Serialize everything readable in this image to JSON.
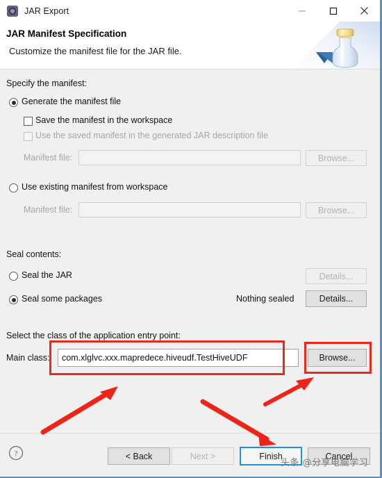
{
  "window": {
    "title": "JAR Export",
    "icon": "jar-export-gear-icon",
    "controls": {
      "minimize": "minimize-icon",
      "maximize": "maximize-icon",
      "close": "close-icon"
    },
    "accent_border_color": "#5d91c6"
  },
  "header": {
    "title": "JAR Manifest Specification",
    "subtitle": "Customize the manifest file for the JAR file.",
    "artwork": "jar-bottle-icon"
  },
  "manifest_section": {
    "group_label": "Specify the manifest:",
    "generate_radio": {
      "label": "Generate the manifest file",
      "checked": true
    },
    "save_checkbox": {
      "label": "Save the manifest in the workspace",
      "checked": false,
      "enabled": true
    },
    "use_saved_checkbox": {
      "label": "Use the saved manifest in the generated JAR description file",
      "checked": false,
      "enabled": false
    },
    "manifest_file_label": "Manifest file:",
    "manifest_file_value": "",
    "manifest_file_browse": "Browse...",
    "existing_radio": {
      "label": "Use existing manifest from workspace",
      "checked": false
    },
    "existing_file_label": "Manifest file:",
    "existing_file_value": "",
    "existing_file_browse": "Browse..."
  },
  "seal_section": {
    "group_label": "Seal contents:",
    "seal_jar_radio": {
      "label": "Seal the JAR",
      "checked": false
    },
    "seal_jar_details": "Details...",
    "seal_packages_radio": {
      "label": "Seal some packages",
      "checked": true
    },
    "seal_status": "Nothing sealed",
    "seal_packages_details": "Details..."
  },
  "entry_point_section": {
    "group_label": "Select the class of the application entry point:",
    "main_class_label": "Main class:",
    "main_class_value": "com.xlglvc.xxx.mapredece.hiveudf.TestHiveUDF",
    "browse_label": "Browse..."
  },
  "footer": {
    "help_icon": "help-question-icon",
    "back_label": "< Back",
    "back_enabled": true,
    "next_label": "Next >",
    "next_enabled": false,
    "finish_label": "Finish",
    "finish_is_default": true,
    "cancel_label": "Cancel"
  },
  "annotations": {
    "highlight_color": "#e8291c",
    "boxes": [
      "main-class-input-highlight",
      "browse-button-highlight"
    ],
    "arrows": [
      "arrow-to-main-class-input",
      "arrow-to-browse-button",
      "arrow-to-finish-button"
    ],
    "watermark": "头条 @分享电脑学习"
  }
}
